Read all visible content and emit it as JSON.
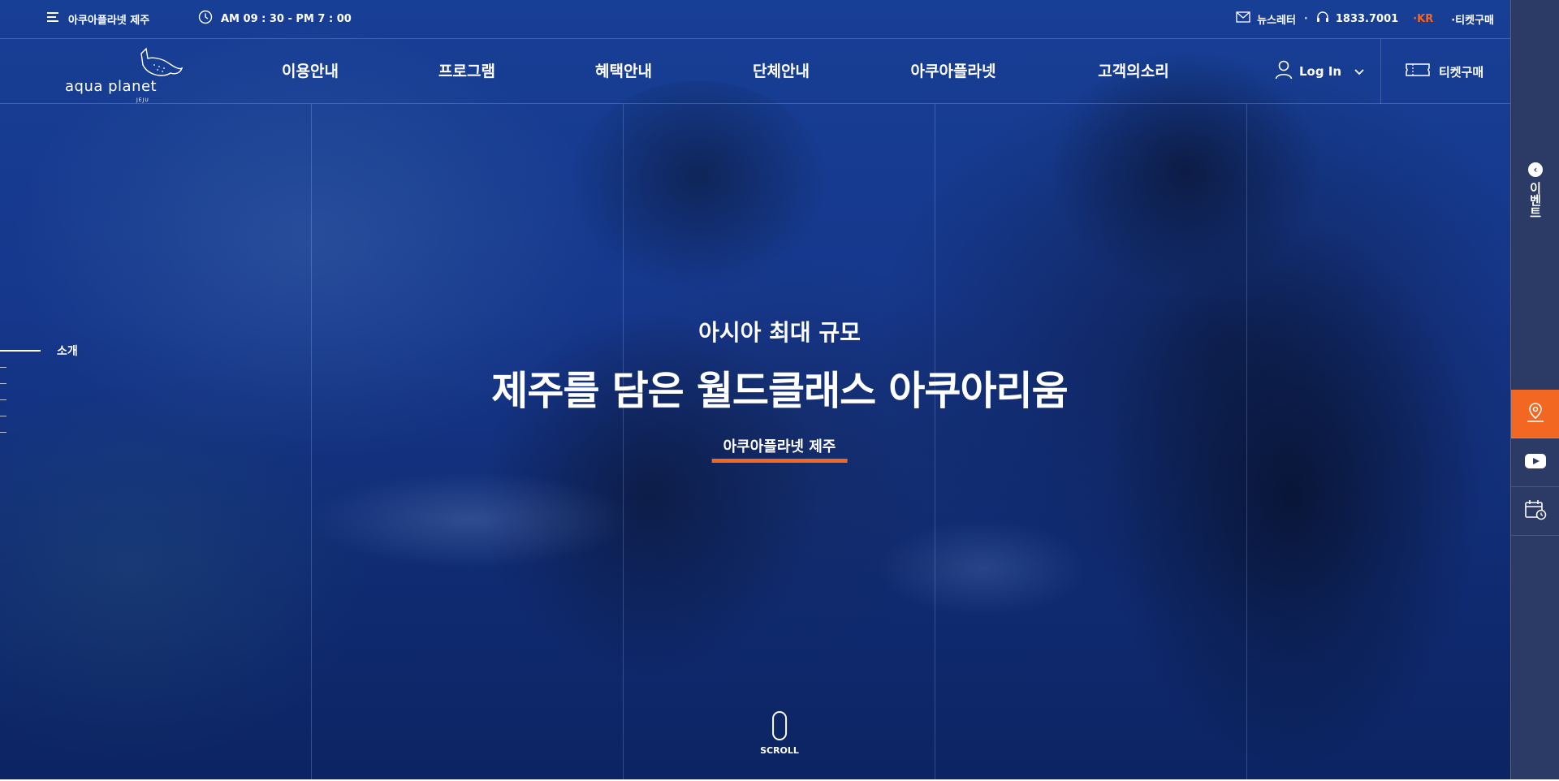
{
  "topbar": {
    "menu_label": "아쿠아플라넷 제주",
    "hours": "AM 09 : 30 - PM 7 : 00",
    "newsletter": "뉴스레터",
    "sep": "·",
    "phone": "1833.7001",
    "lang": "·KR",
    "ticket": "·티켓구매"
  },
  "logo": {
    "word": "aqua planet",
    "sub": "JEJU"
  },
  "nav": {
    "items": [
      "이용안내",
      "프로그램",
      "혜택안내",
      "단체안내",
      "아쿠아플라넷",
      "고객의소리"
    ],
    "login": "Log In",
    "ticket": "티켓구매"
  },
  "left_indicator": {
    "label": "소개"
  },
  "hero": {
    "subtitle": "아시아 최대 규모",
    "title": "제주를 담은 월드클래스 아쿠아리움",
    "cta": "아쿠아플라넷 제주"
  },
  "scroll": {
    "label": "SCROLL"
  },
  "sidebar": {
    "event_label": "이벤트",
    "event_arrow": "‹"
  },
  "colors": {
    "accent": "#f26722",
    "sidebar_bg": "#2c3a66",
    "hero_base": "#16378c"
  }
}
